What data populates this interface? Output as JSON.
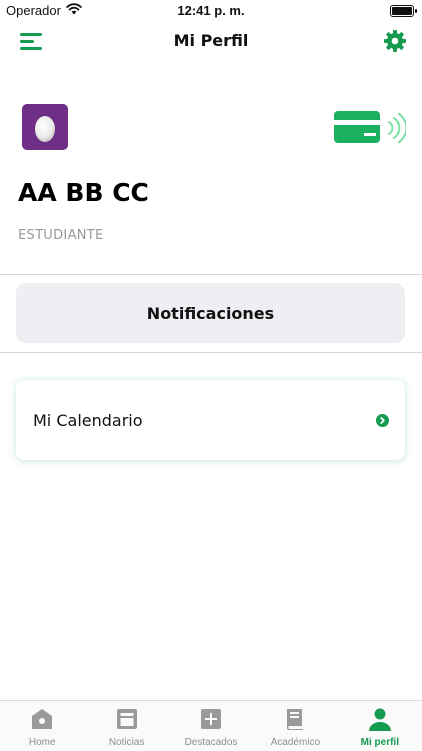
{
  "colors": {
    "accent": "#159a4f",
    "card_green": "#1bb060",
    "avatar_bg": "#6f2f86",
    "muted_text": "#999999",
    "button_bg": "#eeeef3",
    "tab_inactive": "#8e8e93"
  },
  "status_bar": {
    "carrier": "Operador",
    "time": "12:41 p. m.",
    "icons": [
      "wifi-icon",
      "battery-icon"
    ]
  },
  "nav": {
    "title": "Mi Perfil",
    "left_icon": "menu-icon",
    "right_icon": "gear-icon"
  },
  "profile": {
    "avatar_icon": "egg-icon",
    "card_icon": "contactless-card-icon",
    "name": "AA BB CC",
    "role": "ESTUDIANTE"
  },
  "actions": {
    "notifications_label": "Notificaciones"
  },
  "calendar": {
    "label": "Mi Calendario",
    "icon": "chevron-right-icon"
  },
  "tabs": [
    {
      "label": "Home",
      "icon": "home-icon",
      "active": false
    },
    {
      "label": "Noticias",
      "icon": "news-icon",
      "active": false
    },
    {
      "label": "Destacados",
      "icon": "plus-square-icon",
      "active": false
    },
    {
      "label": "Académico",
      "icon": "book-icon",
      "active": false
    },
    {
      "label": "Mi perfil",
      "icon": "person-icon",
      "active": true
    }
  ]
}
